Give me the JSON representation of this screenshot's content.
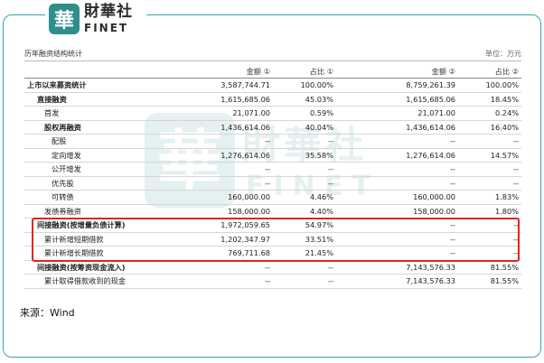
{
  "brand": {
    "logo_char": "華",
    "name_cn": "財華社",
    "name_en": "FINET"
  },
  "table": {
    "title": "历年融资结构统计",
    "unit": "单位：万元",
    "headers": [
      "",
      "金额 ①",
      "占比 ①",
      "金额 ②",
      "占比 ②"
    ],
    "rows": [
      {
        "label": "上市以来募资统计",
        "level": 0,
        "bold": true,
        "values": [
          "3,587,744.71",
          "100.00%",
          "8,759,261.39",
          "100.00%"
        ]
      },
      {
        "label": "直接融资",
        "level": 1,
        "bold": true,
        "values": [
          "1,615,685.06",
          "45.03%",
          "1,615,685.06",
          "18.45%"
        ]
      },
      {
        "label": "首发",
        "level": 2,
        "bold": false,
        "values": [
          "21,071.00",
          "0.59%",
          "21,071.00",
          "0.24%"
        ]
      },
      {
        "label": "股权再融资",
        "level": 2,
        "bold": true,
        "values": [
          "1,436,614.06",
          "40.04%",
          "1,436,614.06",
          "16.40%"
        ]
      },
      {
        "label": "配股",
        "level": 3,
        "bold": false,
        "values": [
          "--",
          "--",
          "--",
          "--"
        ]
      },
      {
        "label": "定向增发",
        "level": 3,
        "bold": false,
        "values": [
          "1,276,614.06",
          "35.58%",
          "1,276,614.06",
          "14.57%"
        ]
      },
      {
        "label": "公开增发",
        "level": 3,
        "bold": false,
        "values": [
          "--",
          "--",
          "--",
          "--"
        ]
      },
      {
        "label": "优先股",
        "level": 3,
        "bold": false,
        "values": [
          "--",
          "--",
          "--",
          "--"
        ]
      },
      {
        "label": "可转债",
        "level": 3,
        "bold": false,
        "values": [
          "160,000.00",
          "4.46%",
          "160,000.00",
          "1.83%"
        ]
      },
      {
        "label": "发债券融资",
        "level": 2,
        "bold": false,
        "values": [
          "158,000.00",
          "4.40%",
          "158,000.00",
          "1.80%"
        ]
      },
      {
        "label": "间接融资(按增量负债计算)",
        "level": 1,
        "bold": true,
        "values": [
          "1,972,059.65",
          "54.97%",
          "--",
          "--"
        ]
      },
      {
        "label": "累计新增短期借款",
        "level": 2,
        "bold": false,
        "values": [
          "1,202,347.97",
          "33.51%",
          "--",
          "--"
        ]
      },
      {
        "label": "累计新增长期借款",
        "level": 2,
        "bold": false,
        "values": [
          "769,711.68",
          "21.45%",
          "--",
          "--"
        ]
      },
      {
        "label": "间接融资(按筹资现金流入)",
        "level": 1,
        "bold": true,
        "values": [
          "--",
          "--",
          "7,143,576.33",
          "81.55%"
        ]
      },
      {
        "label": "累计取得借款收到的现金",
        "level": 2,
        "bold": false,
        "values": [
          "--",
          "--",
          "7,143,576.33",
          "81.55%"
        ]
      }
    ]
  },
  "source": "来源：Wind",
  "colors": {
    "frame": "#3aa1a8",
    "brand": "#2f8e8c",
    "highlight": "#e0261c"
  }
}
